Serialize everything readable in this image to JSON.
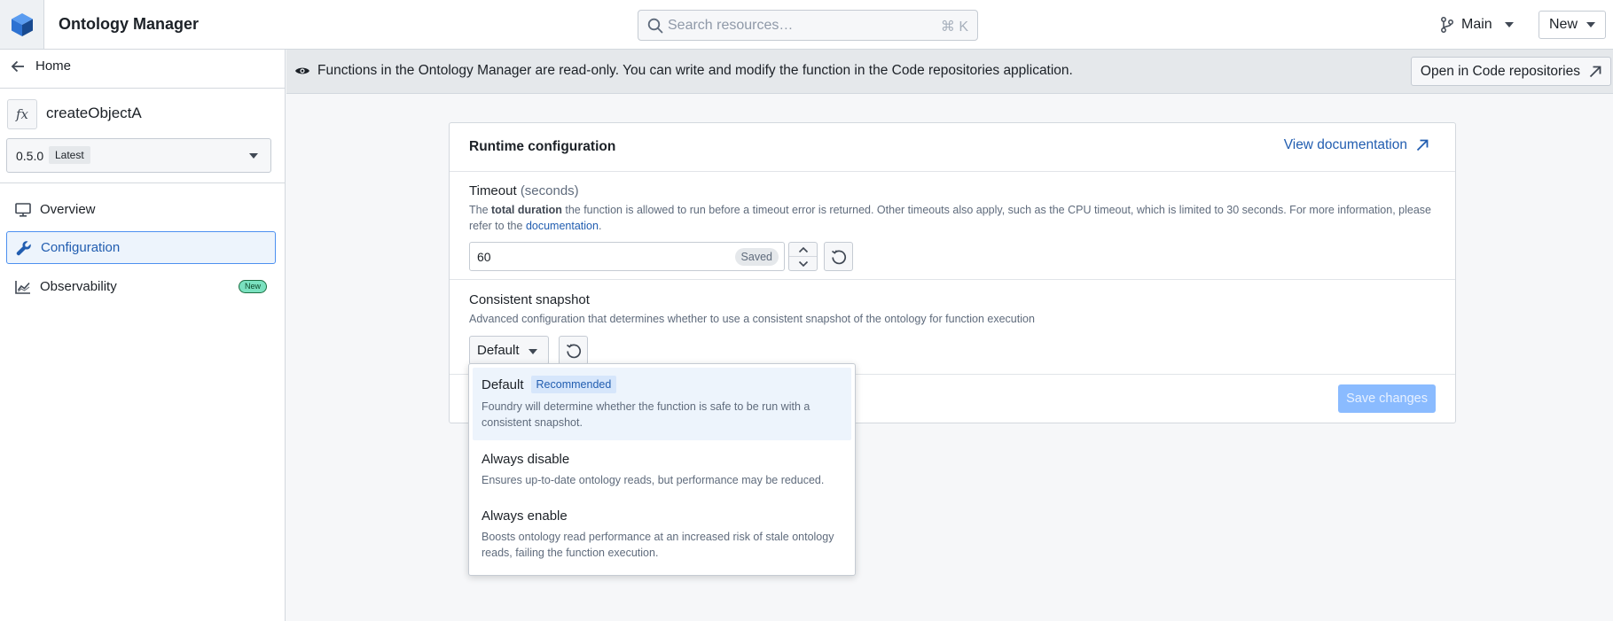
{
  "header": {
    "app_title": "Ontology Manager",
    "search_placeholder": "Search resources…",
    "search_shortcut": "⌘ K",
    "branch_label": "Main",
    "new_label": "New"
  },
  "sidebar": {
    "home_label": "Home",
    "function_icon": "fx",
    "function_name": "createObjectA",
    "version": "0.5.0",
    "version_tag": "Latest",
    "items": [
      {
        "label": "Overview",
        "icon": "monitor-icon",
        "active": false
      },
      {
        "label": "Configuration",
        "icon": "wrench-icon",
        "active": true
      },
      {
        "label": "Observability",
        "icon": "chart-icon",
        "active": false,
        "badge": "New"
      }
    ]
  },
  "banner": {
    "message": "Functions in the Ontology Manager are read-only. You can write and modify the function in the Code repositories application.",
    "button_label": "Open in Code repositories"
  },
  "card": {
    "title": "Runtime configuration",
    "doc_link": "View documentation",
    "timeout": {
      "label": "Timeout",
      "label_unit": "(seconds)",
      "desc_pre": "The ",
      "desc_bold": "total duration",
      "desc_mid": " the function is allowed to run before a timeout error is returned. Other timeouts also apply, such as the CPU timeout, which is limited to 30 seconds. For more information, please refer to the ",
      "desc_link": "documentation",
      "desc_post": ".",
      "value": "60",
      "status": "Saved"
    },
    "snapshot": {
      "label": "Consistent snapshot",
      "desc": "Advanced configuration that determines whether to use a consistent snapshot of the ontology for function execution",
      "selected": "Default"
    },
    "save_label": "Save changes"
  },
  "menu": {
    "options": [
      {
        "title": "Default",
        "tag": "Recommended",
        "desc": "Foundry will determine whether the function is safe to be run with a consistent snapshot.",
        "selected": true
      },
      {
        "title": "Always disable",
        "desc": "Ensures up-to-date ontology reads, but performance may be reduced.",
        "selected": false
      },
      {
        "title": "Always enable",
        "desc": "Boosts ontology read performance at an increased risk of stale ontology reads, failing the function execution.",
        "selected": false
      }
    ]
  },
  "colors": {
    "accent": "#215db0",
    "active_bg": "#edf4fc",
    "banner_bg": "#e5e8eb",
    "badge_green": "#7ae1bf",
    "disabled_primary": "#8abbff"
  }
}
